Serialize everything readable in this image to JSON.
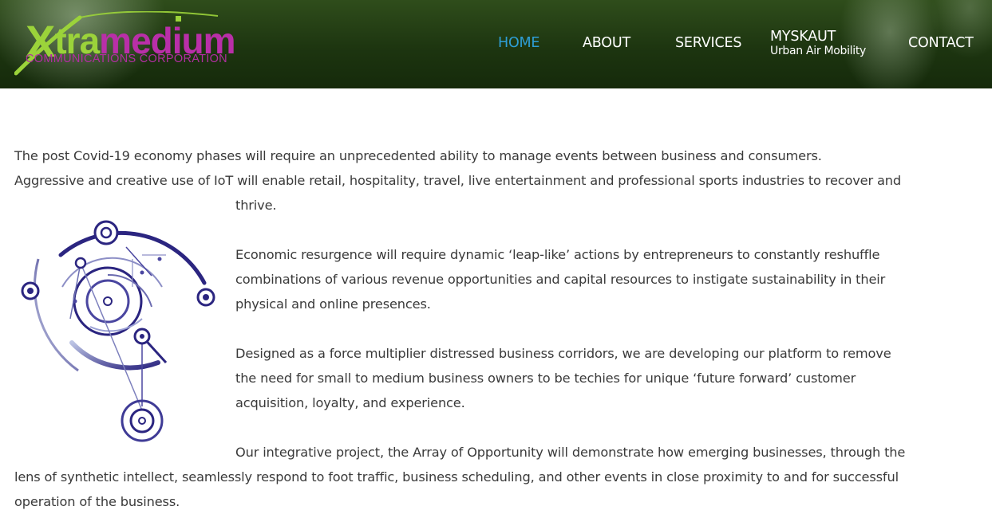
{
  "header": {
    "logo": {
      "x": "X",
      "tra": "tra",
      "medium": "medium",
      "subtitle": "COMMUNICATIONS CORPORATION"
    },
    "nav": [
      {
        "label": "HOME",
        "active": true
      },
      {
        "label": "ABOUT",
        "active": false
      },
      {
        "label": "SERVICES",
        "active": false
      },
      {
        "label": "MYSKAUT",
        "sublabel": "Urban Air Mobility",
        "active": false
      },
      {
        "label": "CONTACT",
        "active": false
      }
    ]
  },
  "main": {
    "lines": [
      "The post Covid-19 economy phases will require an unprecedented ability to manage events between business and consumers.",
      "Aggressive and creative use of IoT will enable retail, hospitality, travel, live entertainment and professional sports industries to recover and",
      "thrive.",
      "Economic resurgence will require dynamic ‘leap-like’ actions by entrepreneurs to constantly reshuffle",
      "combinations of various revenue opportunities and capital resources to instigate sustainability in their",
      "physical and online presences.",
      "Designed as a force multiplier distressed business corridors, we are developing our platform to remove",
      "the need for small to medium business owners to be techies for unique ‘future forward’ customer",
      "acquisition, loyalty, and experience.",
      "Our integrative project, the Array of Opportunity will demonstrate how emerging businesses, through the",
      "lens of synthetic intellect, seamlessly respond to foot traffic, business scheduling, and other events in close proximity to and for successful",
      "operation of the business."
    ]
  },
  "colors": {
    "nav_active": "#2e9ed6",
    "nav_text": "#ffffff",
    "logo_green": "#9bd33a",
    "logo_magenta": "#b92fa8",
    "illustration_primary": "#2b2580"
  },
  "icons": {
    "illustration": "circuit-orbit-illustration"
  }
}
